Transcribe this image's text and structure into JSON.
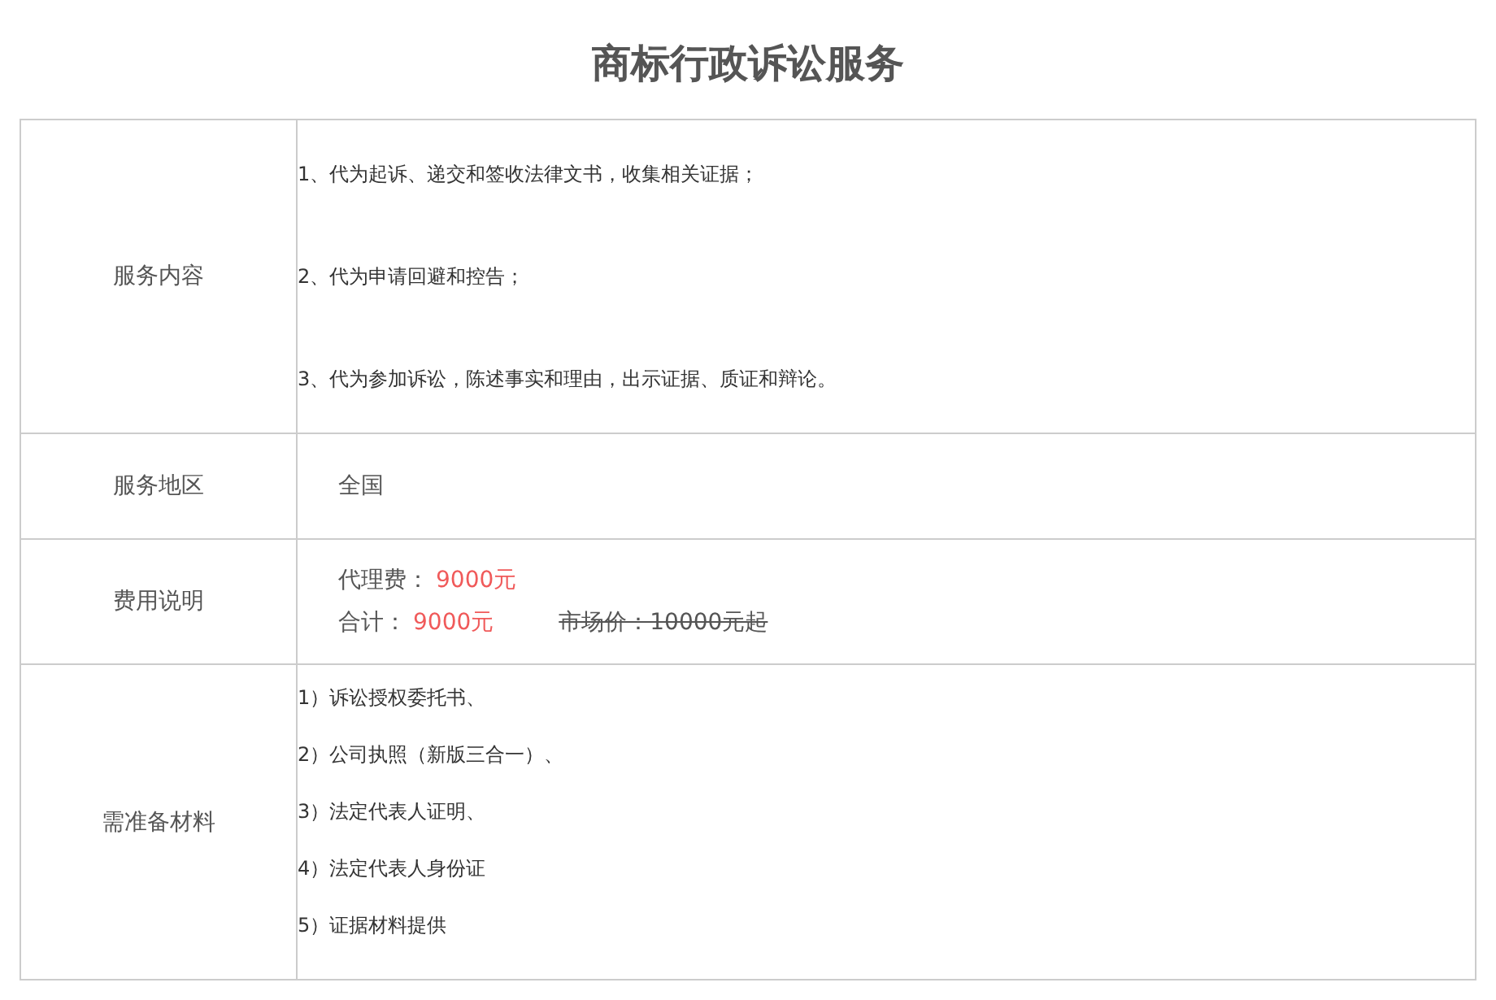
{
  "title": "商标行政诉讼服务",
  "rows": [
    {
      "kind": "paragraphs",
      "label": "服务内容",
      "items": [
        "1、代为起诉、递交和签收法律文书，收集相关证据；",
        "2、代为申请回避和控告；",
        "3、代为参加诉讼，陈述事实和理由，出示证据、质证和辩论。"
      ]
    },
    {
      "kind": "text",
      "label": "服务地区",
      "text": "全国"
    },
    {
      "kind": "pricing",
      "label": "费用说明",
      "fee": {
        "label": "代理费：",
        "value": "9000元"
      },
      "total": {
        "label": "合计：",
        "value": "9000元"
      },
      "market": {
        "text": "市场价：10000元起",
        "struck": true
      }
    },
    {
      "kind": "list",
      "label": "需准备材料",
      "items": [
        "1）诉讼授权委托书、",
        "2）公司执照（新版三合一）、",
        "3）法定代表人证明、",
        "4）法定代表人身份证",
        "5）证据材料提供"
      ]
    }
  ]
}
